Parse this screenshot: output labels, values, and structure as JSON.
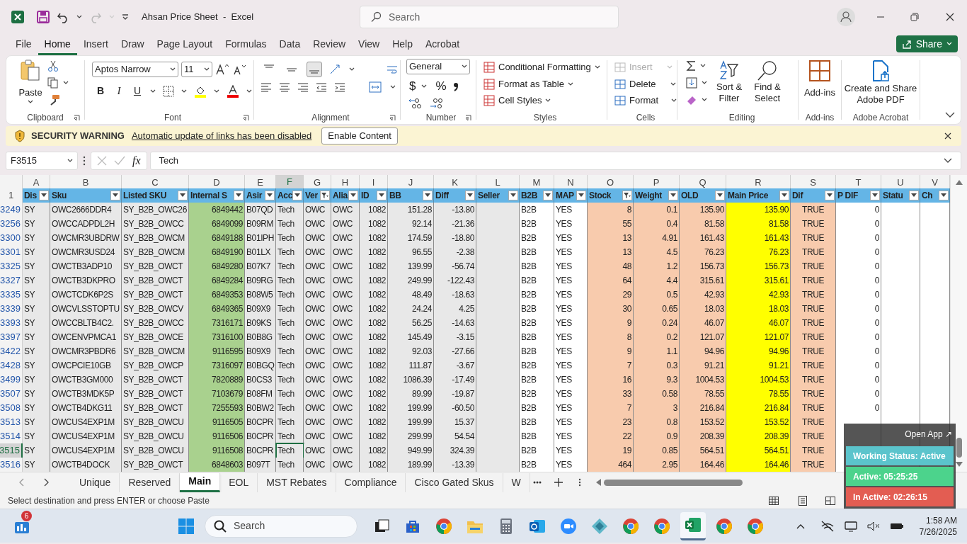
{
  "window": {
    "title": "Ahsan Price Sheet  -  Excel",
    "search_placeholder": "Search"
  },
  "menu_tabs": [
    {
      "label": "File",
      "selected": false
    },
    {
      "label": "Home",
      "selected": true
    },
    {
      "label": "Insert",
      "selected": false
    },
    {
      "label": "Draw",
      "selected": false
    },
    {
      "label": "Page Layout",
      "selected": false
    },
    {
      "label": "Formulas",
      "selected": false
    },
    {
      "label": "Data",
      "selected": false
    },
    {
      "label": "Review",
      "selected": false
    },
    {
      "label": "View",
      "selected": false
    },
    {
      "label": "Help",
      "selected": false
    },
    {
      "label": "Acrobat",
      "selected": false
    }
  ],
  "share_button": "Share",
  "ribbon": {
    "groups": [
      {
        "kind": "clipboard",
        "label": "Clipboard",
        "paste": "Paste"
      },
      {
        "kind": "font",
        "label": "Font",
        "font_name": "Aptos Narrow",
        "font_size": "11",
        "format_buttons": [
          "B",
          "I",
          "U"
        ]
      },
      {
        "kind": "alignment",
        "label": "Alignment"
      },
      {
        "kind": "number",
        "label": "Number",
        "format": "General",
        "symbols": [
          "$",
          "%"
        ]
      },
      {
        "kind": "styles",
        "label": "Styles",
        "buttons": [
          "Conditional Formatting",
          "Format as Table",
          "Cell Styles"
        ]
      },
      {
        "kind": "cells",
        "label": "Cells",
        "buttons": [
          {
            "label": "Insert",
            "disabled": true
          },
          {
            "label": "Delete",
            "disabled": false
          },
          {
            "label": "Format",
            "disabled": false
          }
        ]
      },
      {
        "kind": "editing",
        "label": "Editing",
        "buttons": [
          "Sort & Filter",
          "Find & Select"
        ]
      },
      {
        "kind": "addins",
        "label": "Add-ins",
        "button": "Add-ins"
      },
      {
        "kind": "acrobat",
        "label": "Adobe Acrobat",
        "button": "Create and Share Adobe PDF"
      }
    ]
  },
  "security_bar": {
    "label": "SECURITY WARNING",
    "message": "Automatic update of links has been disabled",
    "button": "Enable Content"
  },
  "formula_bar": {
    "name_box": "F3515",
    "function_label": "fx",
    "value": "Tech"
  },
  "sheet": {
    "header_row": "1",
    "columns": [
      {
        "letter": "A",
        "header": "Dis",
        "kind": "text",
        "color": "#e8e8e8",
        "filtered": false,
        "selected": false
      },
      {
        "letter": "B",
        "header": "Sku",
        "kind": "text",
        "color": "#e8e8e8",
        "filtered": false,
        "selected": false
      },
      {
        "letter": "C",
        "header": "Listed SKU",
        "kind": "text",
        "color": "#e8e8e8",
        "filtered": false,
        "selected": false
      },
      {
        "letter": "D",
        "header": "Internal S",
        "kind": "number",
        "color": "#a9d18e",
        "filtered": false,
        "selected": false
      },
      {
        "letter": "E",
        "header": "Asir",
        "kind": "text",
        "color": "#e8e8e8",
        "filtered": false,
        "selected": false
      },
      {
        "letter": "F",
        "header": "Acc",
        "kind": "text",
        "color": "#e8e8e8",
        "filtered": false,
        "selected": true
      },
      {
        "letter": "G",
        "header": "Ver",
        "kind": "text",
        "color": "#e8e8e8",
        "filtered": true,
        "selected": false
      },
      {
        "letter": "H",
        "header": "Alia",
        "kind": "text",
        "color": "#e8e8e8",
        "filtered": false,
        "selected": false
      },
      {
        "letter": "I",
        "header": "ID",
        "kind": "number",
        "color": "#e8e8e8",
        "filtered": false,
        "selected": false
      },
      {
        "letter": "J",
        "header": "BB",
        "kind": "number",
        "color": "#e8e8e8",
        "filtered": false,
        "selected": false
      },
      {
        "letter": "K",
        "header": "Diff",
        "kind": "number",
        "color": "#e8e8e8",
        "filtered": false,
        "selected": false
      },
      {
        "letter": "L",
        "header": "Seller",
        "kind": "text",
        "color": "#e8e8e8",
        "filtered": false,
        "selected": false
      },
      {
        "letter": "M",
        "header": "B2B",
        "kind": "text",
        "color": "#ffffff",
        "filtered": false,
        "selected": false
      },
      {
        "letter": "N",
        "header": "MAP",
        "kind": "text",
        "color": "#ffffff",
        "filtered": false,
        "selected": false
      },
      {
        "letter": "O",
        "header": "Stock",
        "kind": "number",
        "color": "#f8cbad",
        "filtered": true,
        "selected": false
      },
      {
        "letter": "P",
        "header": "Weight",
        "kind": "number",
        "color": "#f8cbad",
        "filtered": false,
        "selected": false
      },
      {
        "letter": "Q",
        "header": "OLD",
        "kind": "number",
        "color": "#f8cbad",
        "filtered": false,
        "selected": false
      },
      {
        "letter": "R",
        "header": "Main Price",
        "kind": "number",
        "color": "#ffff00",
        "filtered": false,
        "selected": false
      },
      {
        "letter": "S",
        "header": "Dif",
        "kind": "boolean",
        "color": "#f8cbad",
        "filtered": false,
        "selected": false
      },
      {
        "letter": "T",
        "header": "P DIF",
        "kind": "number",
        "color": "#ffffff",
        "filtered": false,
        "selected": false
      },
      {
        "letter": "U",
        "header": "Statu",
        "kind": "text",
        "color": "#ffffff",
        "filtered": false,
        "selected": false
      },
      {
        "letter": "V",
        "header": "Ch",
        "kind": "text",
        "color": "#ffffff",
        "filtered": false,
        "selected": false
      }
    ],
    "rows": [
      {
        "number": "3249",
        "selected": false,
        "cells": {
          "A": "SY",
          "B": "OWC2666DDR4",
          "C": "SY_B2B_OWC26",
          "D": "6849442",
          "E": "B07QD",
          "F": "Tech",
          "G": "OWC",
          "H": "OWC",
          "I": "1082",
          "J": "151.28",
          "K": "-13.80",
          "M": "B2B",
          "N": "YES",
          "O": "8",
          "P": "0.1",
          "Q": "135.90",
          "R": "135.90",
          "S": "TRUE",
          "T": "0"
        }
      },
      {
        "number": "3256",
        "selected": false,
        "cells": {
          "A": "SY",
          "B": "OWCCADPDL2H",
          "C": "SY_B2B_OWCC",
          "D": "6849099",
          "E": "B09RM",
          "F": "Tech",
          "G": "OWC",
          "H": "OWC",
          "I": "1082",
          "J": "92.14",
          "K": "-21.36",
          "M": "B2B",
          "N": "YES",
          "O": "55",
          "P": "0.4",
          "Q": "81.58",
          "R": "81.58",
          "S": "TRUE",
          "T": "0"
        }
      },
      {
        "number": "3300",
        "selected": false,
        "cells": {
          "A": "SY",
          "B": "OWCMR3UBDRW",
          "C": "SY_B2B_OWCM",
          "D": "6849188",
          "E": "B01IPH",
          "F": "Tech",
          "G": "OWC",
          "H": "OWC",
          "I": "1082",
          "J": "174.59",
          "K": "-18.80",
          "M": "B2B",
          "N": "YES",
          "O": "13",
          "P": "4.91",
          "Q": "161.43",
          "R": "161.43",
          "S": "TRUE",
          "T": "0"
        }
      },
      {
        "number": "3301",
        "selected": false,
        "cells": {
          "A": "SY",
          "B": "OWCMR3USD24",
          "C": "SY_B2B_OWCM",
          "D": "6849190",
          "E": "B01LX",
          "F": "Tech",
          "G": "OWC",
          "H": "OWC",
          "I": "1082",
          "J": "96.55",
          "K": "-2.38",
          "M": "B2B",
          "N": "YES",
          "O": "13",
          "P": "4.5",
          "Q": "76.23",
          "R": "76.23",
          "S": "TRUE",
          "T": "0"
        }
      },
      {
        "number": "3325",
        "selected": false,
        "cells": {
          "A": "SY",
          "B": "OWCTB3ADP10",
          "C": "SY_B2B_OWCT",
          "D": "6849280",
          "E": "B07K7",
          "F": "Tech",
          "G": "OWC",
          "H": "OWC",
          "I": "1082",
          "J": "139.99",
          "K": "-56.74",
          "M": "B2B",
          "N": "YES",
          "O": "48",
          "P": "1.2",
          "Q": "156.73",
          "R": "156.73",
          "S": "TRUE",
          "T": "0"
        }
      },
      {
        "number": "3327",
        "selected": false,
        "cells": {
          "A": "SY",
          "B": "OWCTB3DKPRO",
          "C": "SY_B2B_OWCT",
          "D": "6849284",
          "E": "B09RG",
          "F": "Tech",
          "G": "OWC",
          "H": "OWC",
          "I": "1082",
          "J": "249.99",
          "K": "-122.43",
          "M": "B2B",
          "N": "YES",
          "O": "64",
          "P": "4.4",
          "Q": "315.61",
          "R": "315.61",
          "S": "TRUE",
          "T": "0"
        }
      },
      {
        "number": "3335",
        "selected": false,
        "cells": {
          "A": "SY",
          "B": "OWCTCDK6P2S",
          "C": "SY_B2B_OWCT",
          "D": "6849353",
          "E": "B08W5",
          "F": "Tech",
          "G": "OWC",
          "H": "OWC",
          "I": "1082",
          "J": "48.49",
          "K": "-18.63",
          "M": "B2B",
          "N": "YES",
          "O": "29",
          "P": "0.5",
          "Q": "42.93",
          "R": "42.93",
          "S": "TRUE",
          "T": "0"
        }
      },
      {
        "number": "3339",
        "selected": false,
        "cells": {
          "A": "SY",
          "B": "OWCVLSSTOPTU",
          "C": "SY_B2B_OWCV",
          "D": "6849365",
          "E": "B09X9",
          "F": "Tech",
          "G": "OWC",
          "H": "OWC",
          "I": "1082",
          "J": "24.24",
          "K": "4.25",
          "M": "B2B",
          "N": "YES",
          "O": "30",
          "P": "0.65",
          "Q": "18.03",
          "R": "18.03",
          "S": "TRUE",
          "T": "0"
        }
      },
      {
        "number": "3393",
        "selected": false,
        "cells": {
          "A": "SY",
          "B": "OWCCBLTB4C2.",
          "C": "SY_B2B_OWCC",
          "D": "7316171",
          "E": "B09KS",
          "F": "Tech",
          "G": "OWC",
          "H": "OWC",
          "I": "1082",
          "J": "56.25",
          "K": "-14.63",
          "M": "B2B",
          "N": "YES",
          "O": "9",
          "P": "0.24",
          "Q": "46.07",
          "R": "46.07",
          "S": "TRUE",
          "T": "0"
        }
      },
      {
        "number": "3397",
        "selected": false,
        "cells": {
          "A": "SY",
          "B": "OWCENVPMCA1",
          "C": "SY_B2B_OWCE",
          "D": "7316100",
          "E": "B0B8G",
          "F": "Tech",
          "G": "OWC",
          "H": "OWC",
          "I": "1082",
          "J": "145.49",
          "K": "-3.15",
          "M": "B2B",
          "N": "YES",
          "O": "8",
          "P": "0.2",
          "Q": "121.07",
          "R": "121.07",
          "S": "TRUE",
          "T": "0"
        }
      },
      {
        "number": "3422",
        "selected": false,
        "cells": {
          "A": "SY",
          "B": "OWCMR3PBDR6",
          "C": "SY_B2B_OWCM",
          "D": "9116595",
          "E": "B09X9",
          "F": "Tech",
          "G": "OWC",
          "H": "OWC",
          "I": "1082",
          "J": "92.03",
          "K": "-27.66",
          "M": "B2B",
          "N": "YES",
          "O": "9",
          "P": "1.1",
          "Q": "94.96",
          "R": "94.96",
          "S": "TRUE",
          "T": "0"
        }
      },
      {
        "number": "3428",
        "selected": false,
        "cells": {
          "A": "SY",
          "B": "OWCPCIE10GB",
          "C": "SY_B2B_OWCP",
          "D": "7316097",
          "E": "B0BGQ",
          "F": "Tech",
          "G": "OWC",
          "H": "OWC",
          "I": "1082",
          "J": "111.87",
          "K": "-3.67",
          "M": "B2B",
          "N": "YES",
          "O": "7",
          "P": "0.3",
          "Q": "91.21",
          "R": "91.21",
          "S": "TRUE",
          "T": "0"
        }
      },
      {
        "number": "3499",
        "selected": false,
        "cells": {
          "A": "SY",
          "B": "OWCTB3GM000",
          "C": "SY_B2B_OWCT",
          "D": "7820889",
          "E": "B0CS3",
          "F": "Tech",
          "G": "OWC",
          "H": "OWC",
          "I": "1082",
          "J": "1086.39",
          "K": "-17.49",
          "M": "B2B",
          "N": "YES",
          "O": "16",
          "P": "9.3",
          "Q": "1004.53",
          "R": "1004.53",
          "S": "TRUE",
          "T": "0"
        }
      },
      {
        "number": "3507",
        "selected": false,
        "cells": {
          "A": "SY",
          "B": "OWCTB3MDK5P",
          "C": "SY_B2B_OWCT",
          "D": "7103679",
          "E": "B08FM",
          "F": "Tech",
          "G": "OWC",
          "H": "OWC",
          "I": "1082",
          "J": "89.99",
          "K": "-19.87",
          "M": "B2B",
          "N": "YES",
          "O": "33",
          "P": "0.58",
          "Q": "78.55",
          "R": "78.55",
          "S": "TRUE",
          "T": "0"
        }
      },
      {
        "number": "3508",
        "selected": false,
        "cells": {
          "A": "SY",
          "B": "OWCTB4DKG11",
          "C": "SY_B2B_OWCT",
          "D": "7255593",
          "E": "B0BW2",
          "F": "Tech",
          "G": "OWC",
          "H": "OWC",
          "I": "1082",
          "J": "199.99",
          "K": "-60.50",
          "M": "B2B",
          "N": "YES",
          "O": "7",
          "P": "3",
          "Q": "216.84",
          "R": "216.84",
          "S": "TRUE",
          "T": "0"
        }
      },
      {
        "number": "3513",
        "selected": false,
        "cells": {
          "A": "SY",
          "B": "OWCUS4EXP1M",
          "C": "SY_B2B_OWCU",
          "D": "9116505",
          "E": "B0CPR",
          "F": "Tech",
          "G": "OWC",
          "H": "OWC",
          "I": "1082",
          "J": "199.99",
          "K": "15.37",
          "M": "B2B",
          "N": "YES",
          "O": "23",
          "P": "0.8",
          "Q": "153.52",
          "R": "153.52",
          "S": "TRUE"
        }
      },
      {
        "number": "3514",
        "selected": false,
        "cells": {
          "A": "SY",
          "B": "OWCUS4EXP1M",
          "C": "SY_B2B_OWCU",
          "D": "9116506",
          "E": "B0CPR",
          "F": "Tech",
          "G": "OWC",
          "H": "OWC",
          "I": "1082",
          "J": "299.99",
          "K": "54.54",
          "M": "B2B",
          "N": "YES",
          "O": "22",
          "P": "0.9",
          "Q": "208.39",
          "R": "208.39",
          "S": "TRUE"
        }
      },
      {
        "number": "3515",
        "selected": true,
        "cells": {
          "A": "SY",
          "B": "OWCUS4EXP1M",
          "C": "SY_B2B_OWCU",
          "D": "9116508",
          "E": "B0CPR",
          "F": "Tech",
          "G": "OWC",
          "H": "OWC",
          "I": "1082",
          "J": "949.99",
          "K": "324.39",
          "M": "B2B",
          "N": "YES",
          "O": "19",
          "P": "0.85",
          "Q": "564.51",
          "R": "564.51",
          "S": "TRUE"
        }
      },
      {
        "number": "3516",
        "selected": false,
        "cells": {
          "A": "SY",
          "B": "OWCTB4DOCK",
          "C": "SY_B2B_OWCT",
          "D": "6848603",
          "E": "B097T",
          "F": "Tech",
          "G": "OWC",
          "H": "OWC",
          "I": "1082",
          "J": "189.99",
          "K": "-13.39",
          "M": "B2B",
          "N": "YES",
          "O": "464",
          "P": "2.95",
          "Q": "164.46",
          "R": "164.46",
          "S": "TRUE"
        }
      }
    ]
  },
  "sheet_tabs": [
    {
      "label": "Unique",
      "selected": false
    },
    {
      "label": "Reserved",
      "selected": false
    },
    {
      "label": "Main",
      "selected": true
    },
    {
      "label": "EOL",
      "selected": false
    },
    {
      "label": "MST Rebates",
      "selected": false
    },
    {
      "label": "Compliance",
      "selected": false
    },
    {
      "label": "Cisco Gated Skus",
      "selected": false
    },
    {
      "label": "W",
      "selected": false
    }
  ],
  "status_bar": {
    "message": "Select destination and press ENTER or choose Paste"
  },
  "status_widget": {
    "link": "Open App ↗",
    "statuses": [
      {
        "label": "Working Status: Active",
        "color": "#5bc4cc"
      },
      {
        "label": "Active: 05:25:25",
        "color": "#4cd38c"
      },
      {
        "label": "In Active: 02:26:15",
        "color": "#e35d52"
      }
    ]
  },
  "taskbar": {
    "widget_badge": "6",
    "search_placeholder": "Search",
    "apps": [
      {
        "kind": "taskview",
        "active": false
      },
      {
        "kind": "store",
        "active": false
      },
      {
        "kind": "chrome",
        "active": false
      },
      {
        "kind": "explorer",
        "active": false
      },
      {
        "kind": "calculator",
        "active": false
      },
      {
        "kind": "outlook",
        "active": false
      },
      {
        "kind": "zoom",
        "active": false
      },
      {
        "kind": "diamond",
        "active": false
      },
      {
        "kind": "chrome",
        "active": false
      },
      {
        "kind": "chrome",
        "active": false
      },
      {
        "kind": "excel",
        "active": true
      },
      {
        "kind": "chrome",
        "active": false
      },
      {
        "kind": "chrome",
        "active": false
      }
    ],
    "time": "1:58 AM",
    "date": "7/26/2025"
  }
}
